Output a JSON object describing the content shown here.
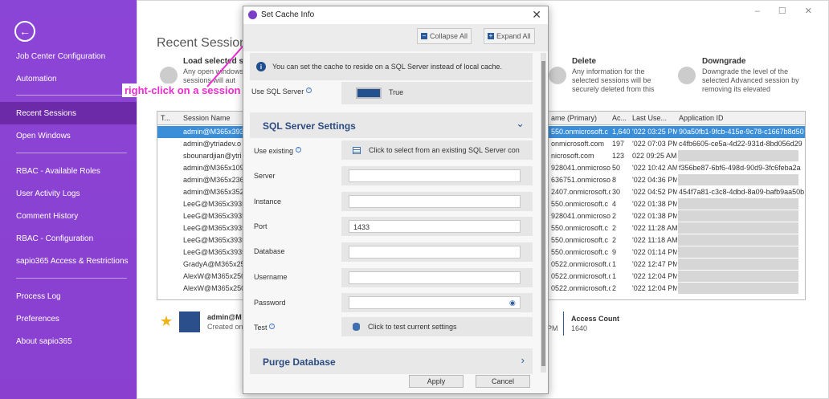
{
  "sidebar": {
    "items": [
      {
        "label": "Job Center Configuration"
      },
      {
        "label": "Automation"
      },
      {
        "label": "Recent Sessions"
      },
      {
        "label": "Open Windows"
      },
      {
        "label": "RBAC - Available Roles"
      },
      {
        "label": "User Activity Logs"
      },
      {
        "label": "Comment History"
      },
      {
        "label": "RBAC - Configuration"
      },
      {
        "label": "sapio365 Access & Restrictions"
      },
      {
        "label": "Process Log"
      },
      {
        "label": "Preferences"
      },
      {
        "label": "About sapio365"
      }
    ]
  },
  "main": {
    "title": "Recent Sessions",
    "actions": [
      {
        "title": "Load selected ses",
        "desc": [
          "Any open windows f",
          "sessions will aut"
        ]
      },
      {
        "title": "Delete",
        "desc": [
          "Any information for the",
          "selected sessions will be",
          "securely deleted from this"
        ]
      },
      {
        "title": "Downgrade",
        "desc": [
          "Downgrade the level of the",
          "selected Advanced session by",
          "removing its elevated"
        ]
      }
    ],
    "grid": {
      "headers": [
        "T...",
        "Session Name",
        "ame (Primary)",
        "Ac...",
        "Last Use...",
        "Application ID"
      ],
      "rows": [
        {
          "name": "admin@M365x393",
          "primary": "550.onmicrosoft.c",
          "count": "1,640",
          "last": "'022 03:25 PM",
          "app": "90a50fb1-9fcb-415e-9c78-c1667b8d50"
        },
        {
          "name": "admin@ytriadev.o",
          "primary": "onmicrosoft.com",
          "count": "197",
          "last": "'022 07:03 PM",
          "app": "c4fb6605-ce5a-4d22-931d-8bd056d29"
        },
        {
          "name": "sbounardjian@ytri",
          "primary": "nicrosoft.com",
          "count": "123",
          "last": "022 09:25 AM",
          "app": ""
        },
        {
          "name": "admin@M365x109",
          "primary": "928041.onmicrosoft",
          "count": "50",
          "last": "'022 10:42 AM",
          "app": "f356be87-6bf6-498d-90d9-3fc6feba2a"
        },
        {
          "name": "admin@M365x236",
          "primary": "636751.onmicrosoft",
          "count": "8",
          "last": "'022 04:36 PM",
          "app": ""
        },
        {
          "name": "admin@M365x352",
          "primary": "2407.onmicrosoft.c",
          "count": "30",
          "last": "'022 04:52 PM",
          "app": "454f7a81-c3c8-4dbd-8a09-bafb9aa50b"
        },
        {
          "name": "LeeG@M365x3935",
          "primary": "550.onmicrosoft.c",
          "count": "4",
          "last": "'022 01:38 PM",
          "app": ""
        },
        {
          "name": "LeeG@M365x3935",
          "primary": "928041.onmicrosoft",
          "count": "2",
          "last": "'022 01:38 PM",
          "app": ""
        },
        {
          "name": "LeeG@M365x3935",
          "primary": "550.onmicrosoft.c",
          "count": "2",
          "last": "'022 11:28 AM",
          "app": ""
        },
        {
          "name": "LeeG@M365x3935",
          "primary": "550.onmicrosoft.c",
          "count": "2",
          "last": "'022 11:18 AM",
          "app": ""
        },
        {
          "name": "LeeG@M365x3935",
          "primary": "550.onmicrosoft.c",
          "count": "9",
          "last": "'022 01:14 PM",
          "app": ""
        },
        {
          "name": "GradyA@M365x25",
          "primary": "0522.onmicrosoft.c",
          "count": "1",
          "last": "'022 12:47 PM",
          "app": ""
        },
        {
          "name": "AlexW@M365x250",
          "primary": "0522.onmicrosoft.c",
          "count": "1",
          "last": "'022 12:04 PM",
          "app": ""
        },
        {
          "name": "AlexW@M365x250",
          "primary": "0522.onmicrosoft.c",
          "count": "2",
          "last": "'022 12:04 PM",
          "app": ""
        }
      ]
    },
    "bottom": {
      "name": "admin@M",
      "created": "Created on",
      "pm": "PM",
      "access_label": "Access Count",
      "access_value": "1640"
    }
  },
  "dialog": {
    "title": "Set Cache Info",
    "collapse_all": "Collapse All",
    "expand_all": "Expand All",
    "info": "You can set the cache to reside on a SQL Server instead of local cache.",
    "use_sql_label": "Use SQL Server",
    "use_sql_value": "True",
    "sql_section": "SQL Server Settings",
    "use_existing_label": "Use existing",
    "use_existing_action": "Click to select from an existing SQL Server con",
    "server_label": "Server",
    "server_value": "",
    "instance_label": "Instance",
    "instance_value": "",
    "port_label": "Port",
    "port_value": "1433",
    "database_label": "Database",
    "database_value": "",
    "username_label": "Username",
    "username_value": "",
    "password_label": "Password",
    "password_value": "",
    "test_label": "Test",
    "test_action": "Click to test current settings",
    "purge_section": "Purge Database",
    "apply": "Apply",
    "cancel": "Cancel"
  },
  "annotation": {
    "text": "right-click on a session",
    "color": "#ee2bd0"
  }
}
